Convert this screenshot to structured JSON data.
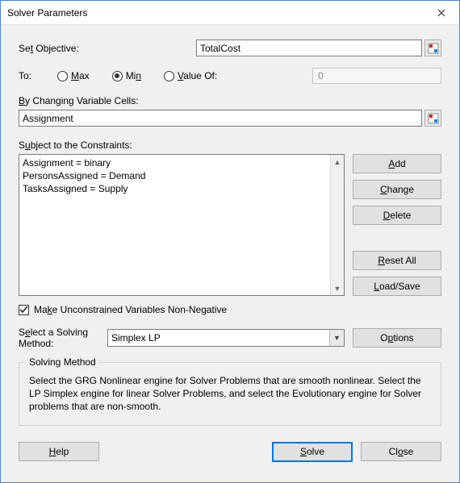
{
  "window": {
    "title": "Solver Parameters"
  },
  "objective": {
    "label_pre": "Se",
    "label_u": "t",
    "label_post": " Objective:",
    "value": "TotalCost"
  },
  "to": {
    "label": "To:",
    "max_u": "M",
    "max_post": "ax",
    "min_pre": "Mi",
    "min_u": "n",
    "val_u": "V",
    "val_post": "alue Of:",
    "value_of_field": "0",
    "selected": "min"
  },
  "changing": {
    "label_u": "B",
    "label_post": "y Changing Variable Cells:",
    "value": "Assignment"
  },
  "constraints": {
    "label_pre": "S",
    "label_u": "u",
    "label_post": "bject to the Constraints:",
    "items": [
      "Assignment = binary",
      "PersonsAssigned = Demand",
      "TasksAssigned = Supply"
    ],
    "buttons": {
      "add_u": "A",
      "add_post": "dd",
      "change_u": "C",
      "change_post": "hange",
      "delete_u": "D",
      "delete_post": "elete",
      "reset_u": "R",
      "reset_post": "eset All",
      "load_u": "L",
      "load_post": "oad/Save"
    }
  },
  "checkbox": {
    "checked": true,
    "label_pre": "Ma",
    "label_u": "k",
    "label_post": "e Unconstrained Variables Non-Negative"
  },
  "method": {
    "label_pre": "S",
    "label_u": "e",
    "label_post": "lect a Solving Method:",
    "value": "Simplex LP",
    "options_pre": "O",
    "options_u": "p",
    "options_post": "tions"
  },
  "groupbox": {
    "legend": "Solving Method",
    "desc": "Select the GRG Nonlinear engine for Solver Problems that are smooth nonlinear. Select the LP Simplex engine for linear Solver Problems, and select the Evolutionary engine for Solver problems that are non-smooth."
  },
  "footer": {
    "help_u": "H",
    "help_post": "elp",
    "solve_u": "S",
    "solve_post": "olve",
    "close_pre": "Cl",
    "close_u": "o",
    "close_post": "se"
  }
}
